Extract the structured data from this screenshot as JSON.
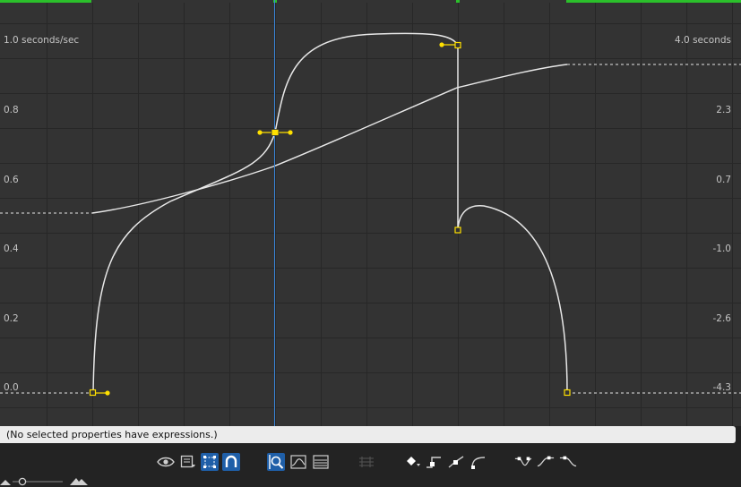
{
  "graph": {
    "left_unit": "1.0 seconds/sec",
    "right_unit": "4.0 seconds",
    "left_ticks": [
      "0.8",
      "0.6",
      "0.4",
      "0.2",
      "0.0"
    ],
    "right_ticks": [
      "2.3",
      "0.7",
      "-1.0",
      "-2.6",
      "-4.3"
    ],
    "colors": {
      "background": "#333333",
      "grid": "#262626",
      "curve": "#e8e8e8",
      "keyframe": "#ffe000",
      "playhead": "#3a86d8",
      "work_area": "#2bc02b"
    }
  },
  "expression_status": "(No selected properties have expressions.)",
  "toolbar": {
    "icons": [
      "eye-icon",
      "graph-type-icon",
      "transform-box-icon",
      "snap-icon",
      "fit-selection-icon",
      "fit-all-icon",
      "fit-all-graphs-icon",
      "separate-dimensions-icon",
      "edit-keyframe-icon",
      "hold-keyframe-icon",
      "linear-keyframe-icon",
      "auto-bezier-icon",
      "easy-ease-icon",
      "easy-ease-in-icon",
      "easy-ease-out-icon"
    ]
  }
}
